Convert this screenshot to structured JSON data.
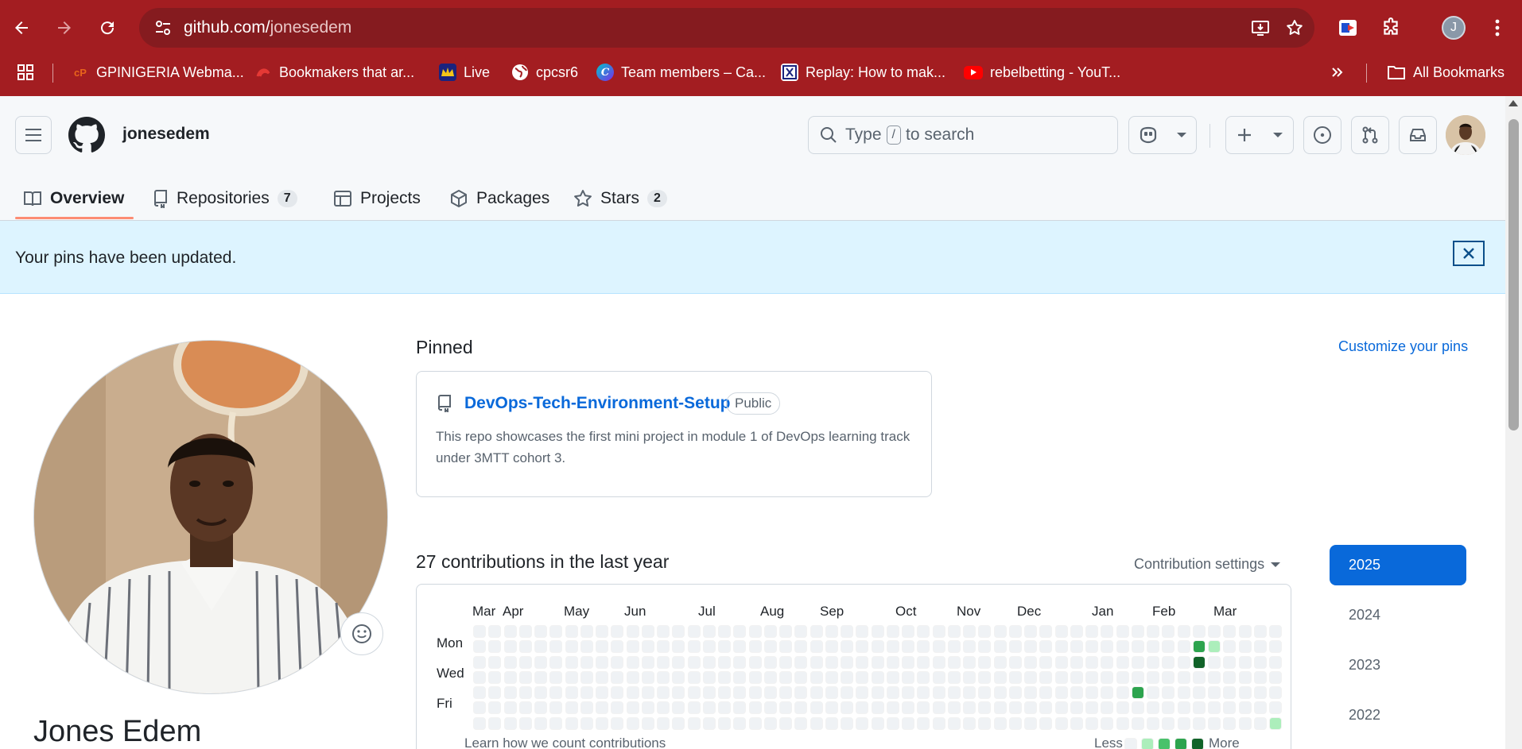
{
  "browser": {
    "url_host": "github.com/",
    "url_path": "jonesedem",
    "profile_initial": "J",
    "bookmarks": [
      {
        "label": "GPINIGERIA Webma...",
        "icon": "gp-icon",
        "color": "#e8641b"
      },
      {
        "label": "Bookmakers that ar...",
        "icon": "swirl-icon",
        "color": "#e53935"
      },
      {
        "label": "Live",
        "icon": "crown-icon",
        "color": "#1a237e"
      },
      {
        "label": "cpcsr6",
        "icon": "globe-icon",
        "color": "#ffffff"
      },
      {
        "label": "Team members – Ca...",
        "icon": "canva-icon",
        "color": "#3b82f6"
      },
      {
        "label": "Replay: How to mak...",
        "icon": "film-icon",
        "color": "#ffffff"
      },
      {
        "label": "rebelbetting - YouT...",
        "icon": "youtube-icon",
        "color": "#ff0000"
      }
    ],
    "all_bookmarks": "All Bookmarks"
  },
  "header": {
    "username": "jonesedem",
    "search_prefix": "Type",
    "search_key": "/",
    "search_suffix": "to search"
  },
  "tabs": [
    {
      "label": "Overview",
      "count": ""
    },
    {
      "label": "Repositories",
      "count": "7"
    },
    {
      "label": "Projects",
      "count": ""
    },
    {
      "label": "Packages",
      "count": ""
    },
    {
      "label": "Stars",
      "count": "2"
    }
  ],
  "flash": {
    "message": "Your pins have been updated."
  },
  "profile": {
    "name": "Jones Edem"
  },
  "pinned": {
    "title": "Pinned",
    "customize": "Customize your pins",
    "repo": {
      "name": "DevOps-Tech-Environment-Setup",
      "visibility": "Public",
      "description": "This repo showcases the first mini project in module 1 of DevOps learning track under 3MTT cohort 3."
    }
  },
  "contributions": {
    "title": "27 contributions in the last year",
    "settings": "Contribution settings",
    "months": [
      "Mar",
      "Apr",
      "May",
      "Jun",
      "Jul",
      "Aug",
      "Sep",
      "Oct",
      "Nov",
      "Dec",
      "Jan",
      "Feb",
      "Mar"
    ],
    "days": [
      "Mon",
      "Wed",
      "Fri"
    ],
    "learn": "Learn how we count contributions",
    "legend_less": "Less",
    "legend_more": "More",
    "active_cells": [
      {
        "week": 47,
        "day": 1,
        "level": 3
      },
      {
        "week": 48,
        "day": 1,
        "level": 1
      },
      {
        "week": 47,
        "day": 2,
        "level": 4
      },
      {
        "week": 43,
        "day": 4,
        "level": 3
      },
      {
        "week": 52,
        "day": 6,
        "level": 1
      }
    ],
    "level_colors": [
      "#eff2f5",
      "#aceebb",
      "#4ac26b",
      "#2da44e",
      "#116329"
    ]
  },
  "years": [
    "2025",
    "2024",
    "2023",
    "2022"
  ]
}
